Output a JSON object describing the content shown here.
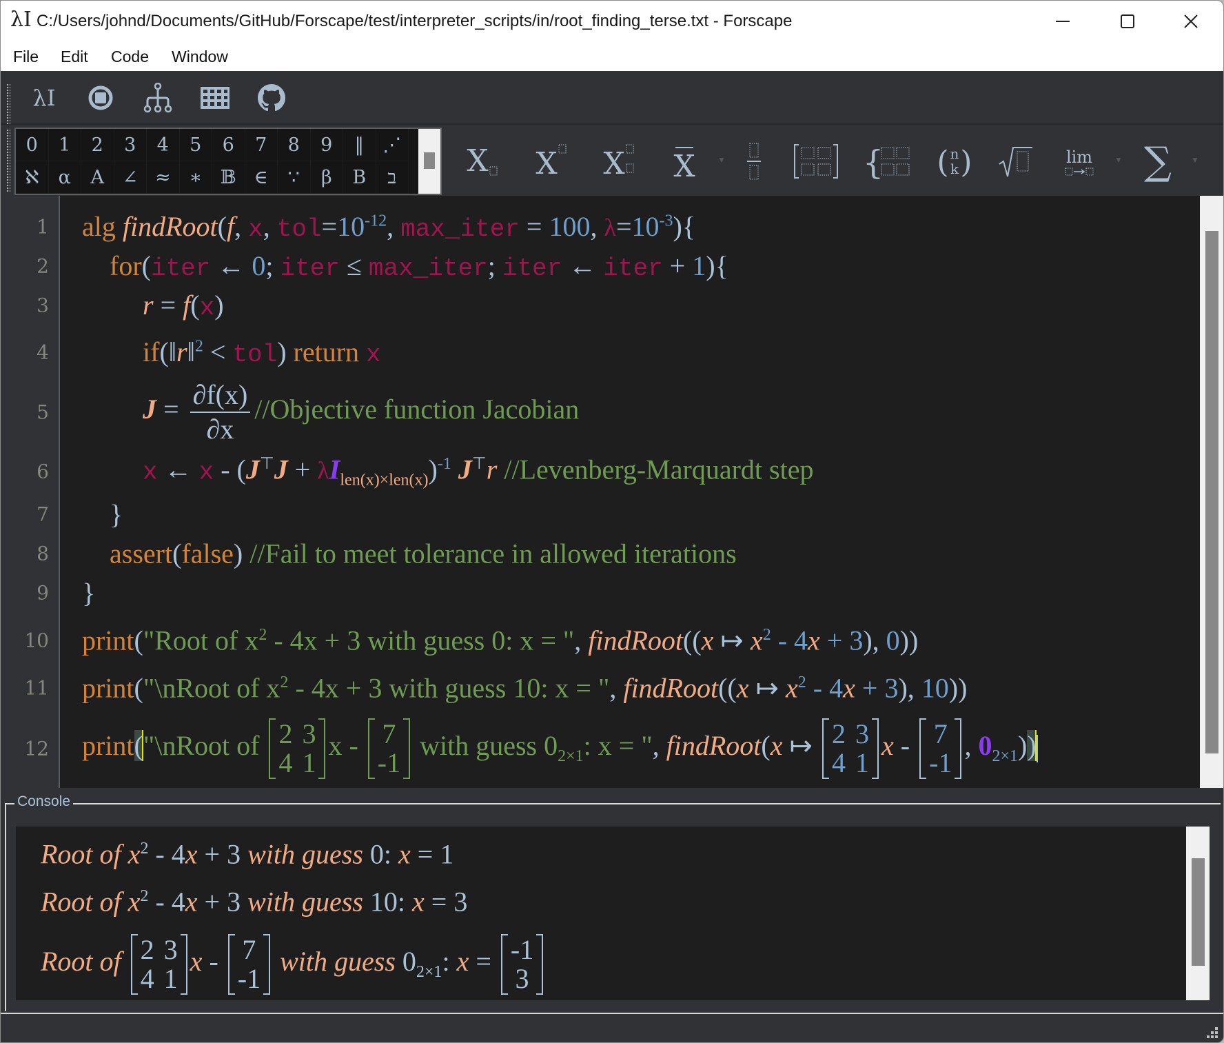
{
  "window": {
    "app_icon": "λI",
    "title": "C:/Users/johnd/Documents/GitHub/Forscape/test/interpreter_scripts/in/root_finding_terse.txt - Forscape",
    "controls": [
      "minimize-icon",
      "maximize-icon",
      "close-icon"
    ]
  },
  "menu": [
    "File",
    "Edit",
    "Code",
    "Window"
  ],
  "toolbar": {
    "buttons": [
      {
        "name": "run-icon",
        "glyph": "λI"
      },
      {
        "name": "stop-icon",
        "glyph": "stop"
      },
      {
        "name": "syntax-tree-icon",
        "glyph": "tree"
      },
      {
        "name": "symbol-table-icon",
        "glyph": "grid"
      },
      {
        "name": "github-icon",
        "glyph": "github"
      }
    ]
  },
  "symbol_panel": {
    "row1": [
      "0",
      "1",
      "2",
      "3",
      "4",
      "5",
      "6",
      "7",
      "8",
      "9",
      "‖",
      "⋰"
    ],
    "row2": [
      "ℵ",
      "α",
      "A",
      "∠",
      "≈",
      "∗",
      "𝔹",
      "∈",
      "∵",
      "β",
      "B",
      "ב"
    ]
  },
  "math_toolbar": [
    {
      "name": "subscript-button",
      "glyph": "X",
      "extra": "sub"
    },
    {
      "name": "superscript-button",
      "glyph": "X",
      "extra": "sup"
    },
    {
      "name": "dualscript-button",
      "glyph": "X",
      "extra": "both"
    },
    {
      "name": "accent-button",
      "glyph": "X̄",
      "dropdown": true
    },
    {
      "name": "fraction-button",
      "glyph": "frac"
    },
    {
      "name": "matrix-button",
      "glyph": "[ ]"
    },
    {
      "name": "cases-button",
      "glyph": "{"
    },
    {
      "name": "binomial-button",
      "glyph": "(n k)"
    },
    {
      "name": "sqrt-button",
      "glyph": "√"
    },
    {
      "name": "limit-button",
      "glyph": "lim",
      "dropdown": true
    },
    {
      "name": "big-operator-button",
      "glyph": "∑",
      "dropdown": true
    }
  ],
  "editor": {
    "line_numbers": [
      "1",
      "2",
      "3",
      "4",
      "5",
      "6",
      "7",
      "8",
      "9",
      "10",
      "11",
      "12"
    ],
    "lines": {
      "l1": {
        "kw": "alg",
        "fn": "findRoot",
        "f": "f",
        "x": "x",
        "tol": "tol",
        "tol_base": "10",
        "tol_exp": "-12",
        "max_iter": "max_iter",
        "max_iter_val": "100",
        "lambda": "λ",
        "lambda_base": "10",
        "lambda_exp": "-3"
      },
      "l2": {
        "kw": "for",
        "iter": "iter",
        "zero": "0",
        "max_iter": "max_iter",
        "one": "1"
      },
      "l3": {
        "r": "r",
        "f": "f",
        "x": "x"
      },
      "l4": {
        "kw_if": "if",
        "r": "r",
        "exp": "2",
        "tol": "tol",
        "kw_return": "return",
        "x": "x"
      },
      "l5": {
        "J": "J",
        "num": "∂f(x)",
        "den": "∂x",
        "comment": "//Objective function Jacobian"
      },
      "l6": {
        "x": "x",
        "J": "J",
        "T": "⊤",
        "lambda": "λ",
        "I": "I",
        "sub": "len(x)×len(x)",
        "exp": "-1",
        "r": "r",
        "comment": "//Levenberg-Marquardt step"
      },
      "l7": {
        "brace": "}"
      },
      "l8": {
        "kw": "assert",
        "arg": "false",
        "comment": "//Fail to meet tolerance in allowed iterations"
      },
      "l9": {
        "brace": "}"
      },
      "l10": {
        "kw": "print",
        "str1": "\"Root of x",
        "str_exp": "2",
        "str2": " - 4x + 3 with guess 0:  x = \"",
        "fn": "findRoot",
        "arg_guess": "0"
      },
      "l11": {
        "kw": "print",
        "str1": "\"\\nRoot of x",
        "str_exp": "2",
        "str2": " - 4x + 3 with guess 10:  x = \"",
        "fn": "findRoot",
        "arg_guess": "10"
      },
      "l12": {
        "kw": "print",
        "str1": "\"\\nRoot of ",
        "matA": [
          "2",
          "3",
          "4",
          "1"
        ],
        "vecB": [
          "7",
          "-1"
        ],
        "str2": " with guess 0",
        "str_sub": "2×1",
        "str3": ":  x = \"",
        "fn": "findRoot",
        "zero": "0",
        "zero_sub": "2×1"
      }
    }
  },
  "console": {
    "label": "Console",
    "outputs": [
      {
        "prefix": "Root of ",
        "var": "x",
        "exp": "2",
        "expr": " - 4",
        "var2": "x",
        "rest": " + 3 ",
        "with": "with guess ",
        "guess": "0:  ",
        "res_var": "x",
        "res": " = 1"
      },
      {
        "prefix": "Root of ",
        "var": "x",
        "exp": "2",
        "expr": " - 4",
        "var2": "x",
        "rest": " + 3 ",
        "with": "with guess ",
        "guess": "10:  ",
        "res_var": "x",
        "res": " = 3"
      },
      {
        "prefix": "Root of ",
        "matA": [
          "2",
          "3",
          "4",
          "1"
        ],
        "var": "x",
        "minus": " - ",
        "vecB": [
          "7",
          "-1"
        ],
        "with": " with guess ",
        "guess": "0",
        "guess_sub": "2×1",
        "colon": ":  ",
        "res_var": "x",
        "eq": " = ",
        "result": [
          "-1",
          "3"
        ]
      }
    ]
  },
  "colors": {
    "keyword": "#d3843a",
    "function": "#f3ab85",
    "variable": "#a3144e",
    "number": "#6f9fcd",
    "comment": "#6d9c52",
    "bracket_highlight": "#e5e500",
    "background": "#1e1e1e"
  }
}
